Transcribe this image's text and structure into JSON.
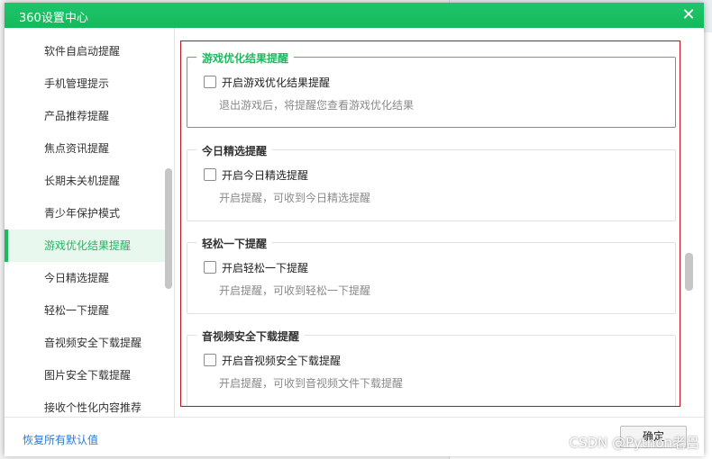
{
  "window": {
    "title": "360设置中心",
    "close_glyph": "✕"
  },
  "sidebar": {
    "items": [
      {
        "label": "软件自启动提醒"
      },
      {
        "label": "手机管理提示"
      },
      {
        "label": "产品推荐提醒"
      },
      {
        "label": "焦点资讯提醒"
      },
      {
        "label": "长期未关机提醒"
      },
      {
        "label": "青少年保护模式"
      },
      {
        "label": "游戏优化结果提醒",
        "active": true
      },
      {
        "label": "今日精选提醒"
      },
      {
        "label": "轻松一下提醒"
      },
      {
        "label": "音视频安全下载提醒"
      },
      {
        "label": "图片安全下载提醒"
      },
      {
        "label": "接收个性化内容推荐"
      }
    ]
  },
  "groups": [
    {
      "title": "游戏优化结果提醒",
      "checkbox_label": "开启游戏优化结果提醒",
      "description": "退出游戏后，将提醒您查看游戏优化结果",
      "checked": false,
      "active": true
    },
    {
      "title": "今日精选提醒",
      "checkbox_label": "开启今日精选提醒",
      "description": "开启提醒，可收到今日精选提醒",
      "checked": false
    },
    {
      "title": "轻松一下提醒",
      "checkbox_label": "开启轻松一下提醒",
      "description": "开启提醒，可收到轻松一下提醒",
      "checked": false
    },
    {
      "title": "音视频安全下载提醒",
      "checkbox_label": "开启音视频安全下载提醒",
      "description": "开启提醒，可收到音视频文件下载提醒",
      "checked": false
    }
  ],
  "footer": {
    "restore_label": "恢复所有默认值",
    "ok_label": "确定"
  },
  "watermark": "CSDN @Python老吕",
  "colors": {
    "accent": "#1db95e",
    "highlight_border": "#c4121c",
    "link": "#2a7ad5"
  }
}
